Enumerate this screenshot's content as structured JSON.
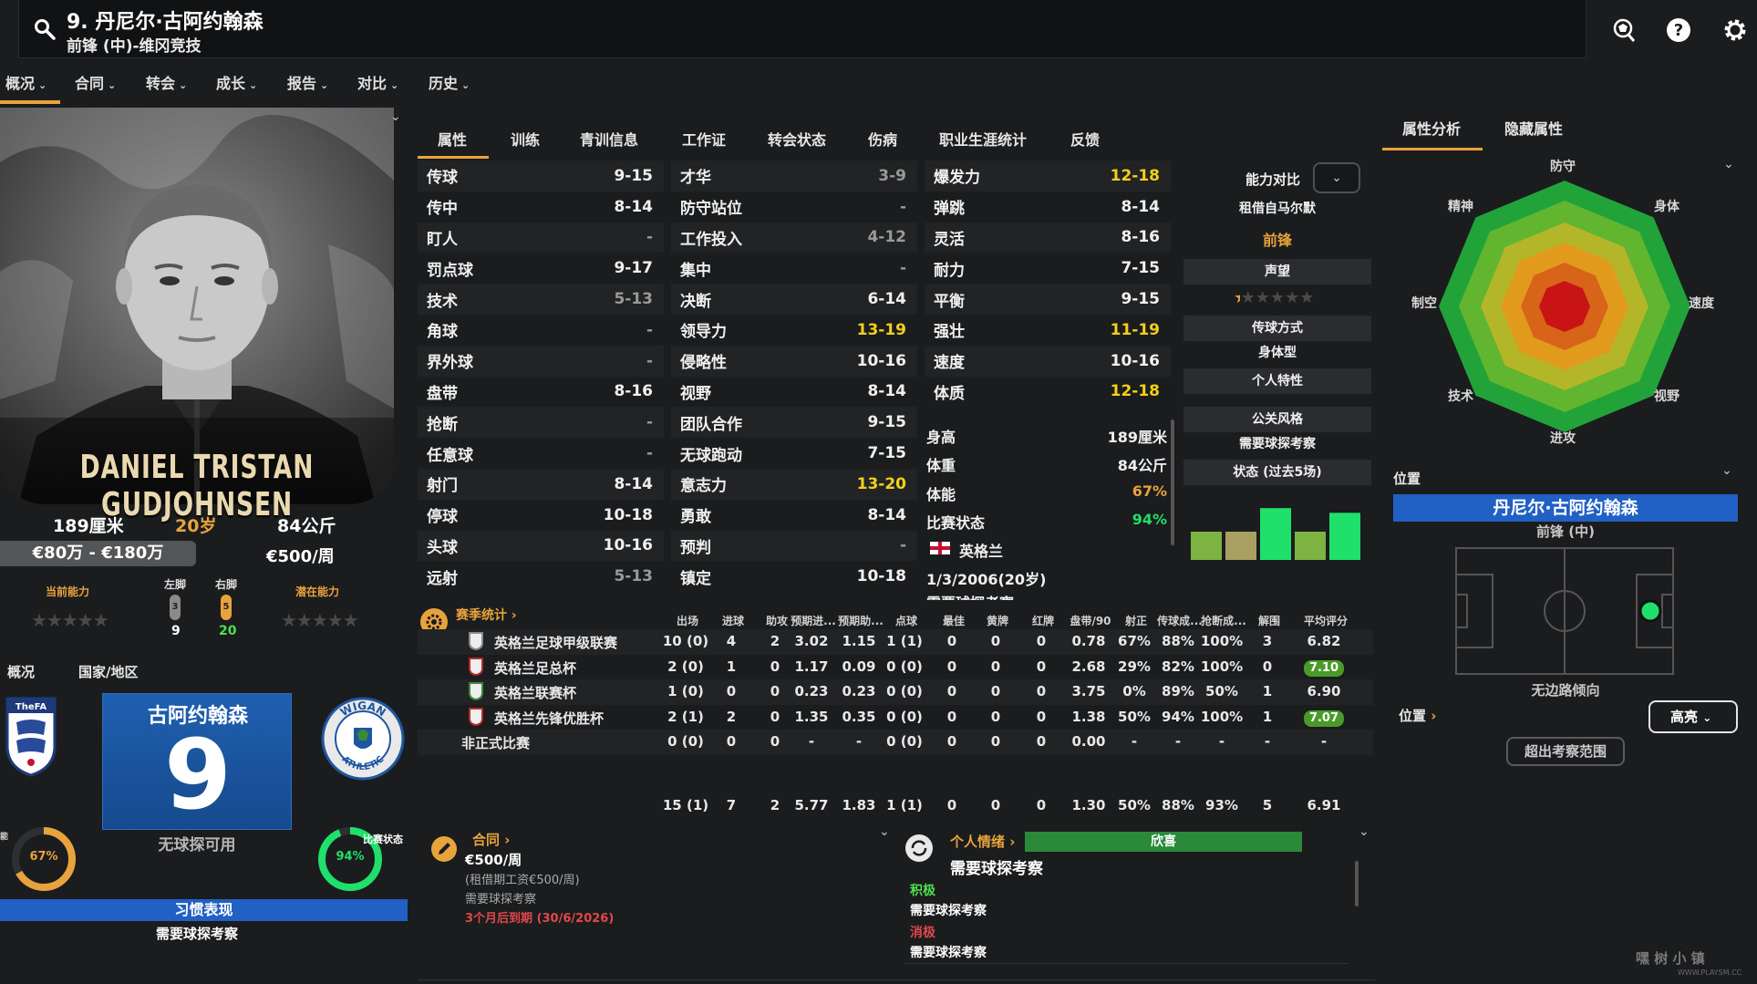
{
  "header": {
    "title": "9. 丹尼尔·古阿约翰森",
    "subtitle": "前锋 (中)-维冈竞技"
  },
  "nav": {
    "items": [
      {
        "label": "概况"
      },
      {
        "label": "合同"
      },
      {
        "label": "转会"
      },
      {
        "label": "成长"
      },
      {
        "label": "报告"
      },
      {
        "label": "对比"
      },
      {
        "label": "历史"
      }
    ]
  },
  "profile": {
    "photo_name": "DANIEL TRISTAN GUDJOHNSEN",
    "height": "189厘米",
    "age": "20岁",
    "weight": "84公斤",
    "value": "€80万 - €180万",
    "wage": "€500/周",
    "current_ability_label": "当前能力",
    "potential_ability_label": "潜在能力",
    "left_foot_label": "左脚",
    "right_foot_label": "右脚",
    "left_foot_badge": "3",
    "right_foot_badge": "5",
    "left_foot_value": "9",
    "right_foot_value": "20",
    "stars_empty": "★★★★★"
  },
  "lower_left": {
    "tab_overview": "概况",
    "tab_nation": "国家/地区",
    "federation_badge": "TheFA",
    "club_badge_top": "WIGAN",
    "club_badge_bottom": "ATHLETIC",
    "shirt_name": "古阿约翰森",
    "shirt_number": "9",
    "no_scout": "无球探可用",
    "fitness_percent": 67,
    "fitness_text": "67%",
    "form_percent": 94,
    "form_text": "94%",
    "form_label": "比赛状态",
    "habits_label": "习惯表现",
    "habits_text": "需要球探考察"
  },
  "mid_tabs": [
    "属性",
    "训练",
    "青训信息",
    "工作证",
    "转会状态",
    "伤病",
    "职业生涯统计",
    "反馈"
  ],
  "attributes": {
    "technical": [
      {
        "name": "传球",
        "value": "9-15",
        "tone": "white"
      },
      {
        "name": "传中",
        "value": "8-14",
        "tone": "white"
      },
      {
        "name": "盯人",
        "value": "-",
        "tone": "gray"
      },
      {
        "name": "罚点球",
        "value": "9-17",
        "tone": "white"
      },
      {
        "name": "技术",
        "value": "5-13",
        "tone": "gray"
      },
      {
        "name": "角球",
        "value": "-",
        "tone": "gray"
      },
      {
        "name": "界外球",
        "value": "-",
        "tone": "gray"
      },
      {
        "name": "盘带",
        "value": "8-16",
        "tone": "white"
      },
      {
        "name": "抢断",
        "value": "-",
        "tone": "gray"
      },
      {
        "name": "任意球",
        "value": "-",
        "tone": "gray"
      },
      {
        "name": "射门",
        "value": "8-14",
        "tone": "white"
      },
      {
        "name": "停球",
        "value": "10-18",
        "tone": "white"
      },
      {
        "name": "头球",
        "value": "10-16",
        "tone": "white"
      },
      {
        "name": "远射",
        "value": "5-13",
        "tone": "gray"
      }
    ],
    "mental": [
      {
        "name": "才华",
        "value": "3-9",
        "tone": "gray"
      },
      {
        "name": "防守站位",
        "value": "-",
        "tone": "gray"
      },
      {
        "name": "工作投入",
        "value": "4-12",
        "tone": "gray"
      },
      {
        "name": "集中",
        "value": "-",
        "tone": "gray"
      },
      {
        "name": "决断",
        "value": "6-14",
        "tone": "white"
      },
      {
        "name": "领导力",
        "value": "13-19",
        "tone": "yellow"
      },
      {
        "name": "侵略性",
        "value": "10-16",
        "tone": "white"
      },
      {
        "name": "视野",
        "value": "8-14",
        "tone": "white"
      },
      {
        "name": "团队合作",
        "value": "9-15",
        "tone": "white"
      },
      {
        "name": "无球跑动",
        "value": "7-15",
        "tone": "white"
      },
      {
        "name": "意志力",
        "value": "13-20",
        "tone": "yellow"
      },
      {
        "name": "勇敢",
        "value": "8-14",
        "tone": "white"
      },
      {
        "name": "预判",
        "value": "-",
        "tone": "gray"
      },
      {
        "name": "镇定",
        "value": "10-18",
        "tone": "white"
      }
    ],
    "physical": [
      {
        "name": "爆发力",
        "value": "12-18",
        "tone": "yellow"
      },
      {
        "name": "弹跳",
        "value": "8-14",
        "tone": "white"
      },
      {
        "name": "灵活",
        "value": "8-16",
        "tone": "white"
      },
      {
        "name": "耐力",
        "value": "7-15",
        "tone": "white"
      },
      {
        "name": "平衡",
        "value": "9-15",
        "tone": "white"
      },
      {
        "name": "强壮",
        "value": "11-19",
        "tone": "yellow"
      },
      {
        "name": "速度",
        "value": "10-16",
        "tone": "white"
      },
      {
        "name": "体质",
        "value": "12-18",
        "tone": "yellow"
      }
    ]
  },
  "info": {
    "height_label": "身高",
    "height_value": "189厘米",
    "weight_label": "体重",
    "weight_value": "84公斤",
    "fitness_label": "体能",
    "fitness_value": "67%",
    "form_label": "比赛状态",
    "form_value": "94%",
    "nation": "英格兰",
    "dob": "1/3/2006(20岁)",
    "cut_off": "需要球探考察"
  },
  "side_panel": {
    "compare_label": "能力对比",
    "loan_from": "租借自马尔默",
    "role": "前锋",
    "reputation_btn": "声望",
    "reputation_stars": "★★★★★",
    "passing_style_btn": "传球方式",
    "body_type": "身体型",
    "traits_btn": "个人特性",
    "media_style_btn": "公关风格",
    "media_style_value": "需要球探考察",
    "form_last5_btn": "状态 (过去5场)",
    "form_bars": [
      {
        "rating": 6.6,
        "color": "#7cb342"
      },
      {
        "rating": 6.6,
        "color": "#a8a060"
      },
      {
        "rating": 7.1,
        "color": "#1fe06a"
      },
      {
        "rating": 6.6,
        "color": "#7cb342"
      },
      {
        "rating": 7.0,
        "color": "#1fe06a"
      }
    ]
  },
  "season": {
    "title": "赛季统计",
    "headers": [
      "出场",
      "进球",
      "助攻",
      "预期进...",
      "预期助...",
      "点球",
      "最佳",
      "黄牌",
      "红牌",
      "盘带/90",
      "射正",
      "传球成...",
      "抢断成...",
      "解围",
      "平均评分"
    ],
    "rows": [
      {
        "comp": "英格兰足球甲级联赛",
        "cells": [
          "10 (0)",
          "4",
          "2",
          "3.02",
          "1.15",
          "1 (1)",
          "0",
          "0",
          "0",
          "0.78",
          "67%",
          "88%",
          "100%",
          "3"
        ],
        "rating": "6.82",
        "pill": false
      },
      {
        "comp": "英格兰足总杯",
        "cells": [
          "2 (0)",
          "1",
          "0",
          "1.17",
          "0.09",
          "0 (0)",
          "0",
          "0",
          "0",
          "2.68",
          "29%",
          "82%",
          "100%",
          "0"
        ],
        "rating": "7.10",
        "pill": true
      },
      {
        "comp": "英格兰联赛杯",
        "cells": [
          "1 (0)",
          "0",
          "0",
          "0.23",
          "0.23",
          "0 (0)",
          "0",
          "0",
          "0",
          "3.75",
          "0%",
          "89%",
          "50%",
          "1"
        ],
        "rating": "6.90",
        "pill": false
      },
      {
        "comp": "英格兰先锋优胜杯",
        "cells": [
          "2 (1)",
          "2",
          "0",
          "1.35",
          "0.35",
          "0 (0)",
          "0",
          "0",
          "0",
          "1.38",
          "50%",
          "94%",
          "100%",
          "1"
        ],
        "rating": "7.07",
        "pill": true
      },
      {
        "comp": "非正式比赛",
        "cells": [
          "0 (0)",
          "0",
          "0",
          "-",
          "-",
          "0 (0)",
          "0",
          "0",
          "0",
          "0.00",
          "-",
          "-",
          "-",
          "-"
        ],
        "rating": "-",
        "pill": false
      }
    ],
    "totals": [
      "15 (1)",
      "7",
      "2",
      "5.77",
      "1.83",
      "1 (1)",
      "0",
      "0",
      "0",
      "1.30",
      "50%",
      "88%",
      "93%",
      "5"
    ],
    "total_rating": "6.91"
  },
  "contract": {
    "title": "合同",
    "wage": "€500/周",
    "loan_wage": "(租借期工资€500/周)",
    "scout_note": "需要球探考察",
    "expiry": "3个月后到期 (30/6/2026)"
  },
  "feelings": {
    "title": "个人情绪",
    "status": "欣喜",
    "note": "需要球探考察",
    "positive_label": "积极",
    "positive_text": "需要球探考察",
    "negative_label": "消极",
    "negative_text": "需要球探考察"
  },
  "right": {
    "tab_analysis": "属性分析",
    "tab_hidden": "隐藏属性",
    "radar_labels": {
      "defense": "防守",
      "physical": "身体",
      "speed": "速度",
      "vision": "视野",
      "attack": "进攻",
      "technique": "技术",
      "aerial": "制空",
      "mental": "精神"
    },
    "position_title": "位置",
    "player_name": "丹尼尔·古阿约翰森",
    "role": "前锋 (中)",
    "pitch_note": "无边路倾向",
    "position_link": "位置",
    "highlight_dd": "高亮",
    "scout_range_btn": "超出考察范围"
  },
  "watermark": "嘿 树 小 镇",
  "watermark_url": "WWW.PLAYSM.CC",
  "colors": {
    "accent": "#e8a33c",
    "blue": "#2160c4",
    "yellow_value": "#f2d01a"
  }
}
